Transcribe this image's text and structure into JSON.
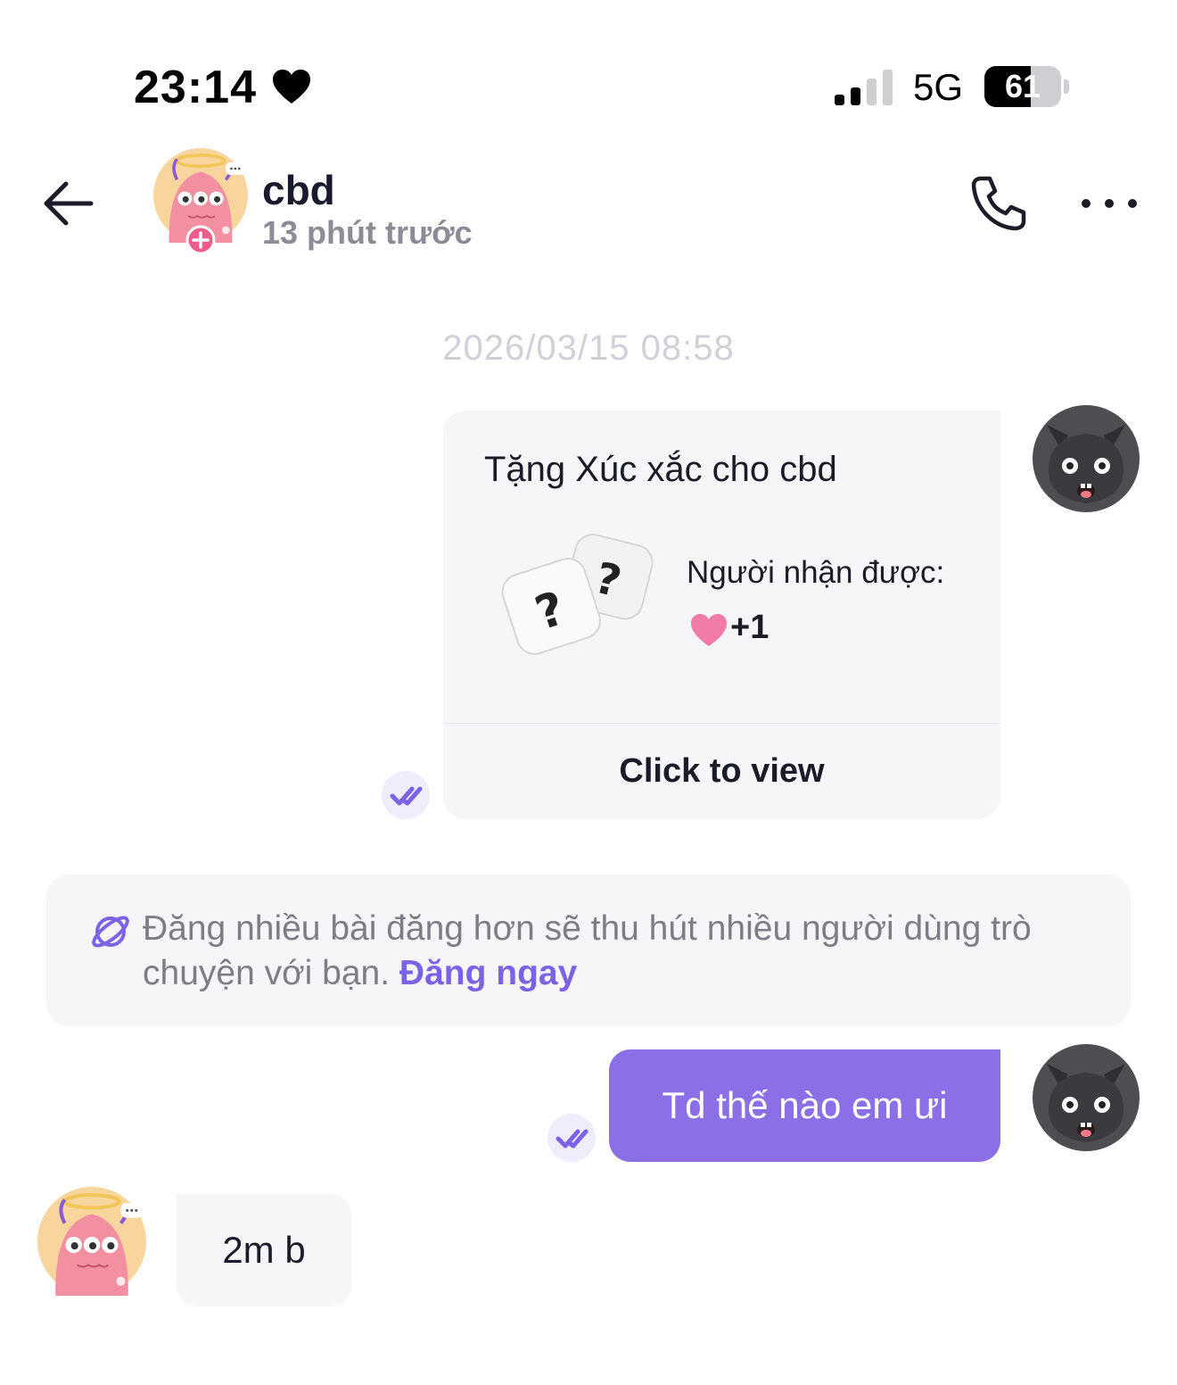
{
  "status_bar": {
    "time": "23:14",
    "network": "5G",
    "battery": "61",
    "battery_level": 0.61
  },
  "header": {
    "name": "cbd",
    "status": "13 phút trước"
  },
  "conversation": {
    "timestamp": "2026/03/15 08:58",
    "gift": {
      "title": "Tặng Xúc xắc cho cbd",
      "recipient_label": "Người nhận được:",
      "reward": "+1",
      "button": "Click to view"
    },
    "tip": {
      "text": "Đăng nhiều bài đăng hơn sẽ thu hút nhiều người dùng trò chuyện với bạn. ",
      "link": "Đăng ngay"
    },
    "messages": [
      {
        "from": "me",
        "text": "Td thế nào em ưi"
      },
      {
        "from": "cbd",
        "text": "2m b"
      }
    ]
  },
  "colors": {
    "accent": "#8a6fe6",
    "link": "#7c63e6",
    "bubble_in": "#f6f6f9",
    "reward_heart": "#f07aa8"
  }
}
